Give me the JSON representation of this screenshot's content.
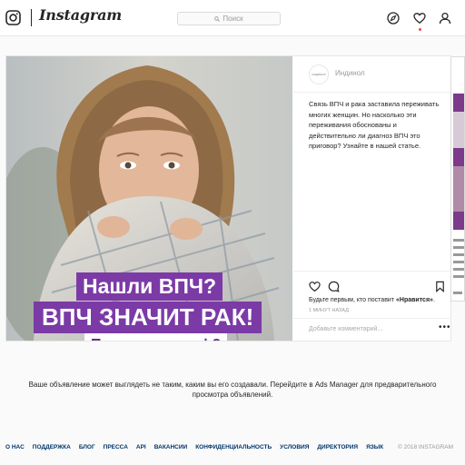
{
  "header": {
    "brand": "Instagram",
    "search_placeholder": "Поиск",
    "icons": [
      "instagram-glyph-icon",
      "compass-icon",
      "heart-icon",
      "profile-icon"
    ]
  },
  "post": {
    "author": "Индинол",
    "avatar_text": "ИНДИНОЛ",
    "caption": "Связь ВПЧ и рака заставила переживать многих женщин. Но насколько эти переживания обоснованы и действительно ли диагноз ВПЧ это приговор? Узнайте в нашей статье.",
    "image_banners": [
      "Нашли ВПЧ?",
      "ВПЧ ЗНАЧИТ РАК!",
      "Правда или миф?"
    ],
    "likes_prefix": "Будьте первым, кто поставит",
    "likes_link": "«Нравится»",
    "likes_suffix": ".",
    "time_ago": "1 МИНУТ НАЗАД",
    "comment_placeholder": "Добавьте комментарий...",
    "more_label": "•••",
    "banner_color": "#7b3aa6"
  },
  "notice": "Ваше объявление может выглядеть не таким, каким вы его создавали. Перейдите в Ads Manager для предварительного просмотра объявлений.",
  "footer": {
    "links": [
      "О НАС",
      "ПОДДЕРЖКА",
      "БЛОГ",
      "ПРЕССА",
      "API",
      "ВАКАНСИИ",
      "КОНФИДЕНЦИАЛЬНОСТЬ",
      "УСЛОВИЯ",
      "ДИРЕКТОРИЯ",
      "ЯЗЫК"
    ],
    "copyright": "© 2018 INSTAGRAM"
  }
}
